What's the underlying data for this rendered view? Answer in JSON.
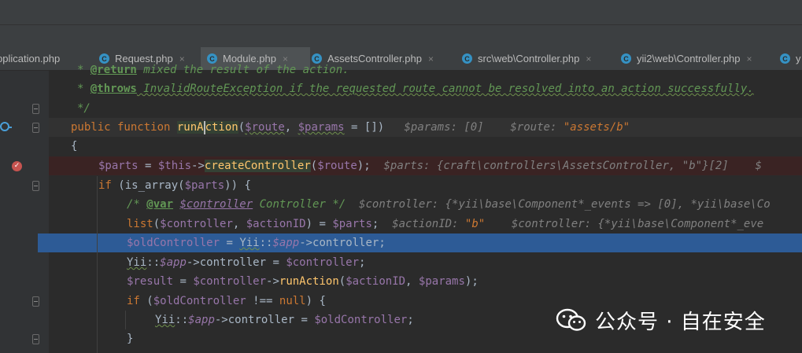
{
  "tabs": [
    {
      "label": "pplication.php",
      "icon_letter": "",
      "active": false
    },
    {
      "label": "Request.php",
      "icon_letter": "C",
      "active": false
    },
    {
      "label": "Module.php",
      "icon_letter": "C",
      "active": true
    },
    {
      "label": "AssetsController.php",
      "icon_letter": "C",
      "active": false
    },
    {
      "label": "src\\web\\Controller.php",
      "icon_letter": "C",
      "active": false
    },
    {
      "label": "yii2\\web\\Controller.php",
      "icon_letter": "C",
      "active": false
    },
    {
      "label": "y",
      "icon_letter": "C",
      "active": false
    }
  ],
  "tab_close_glyph": "×",
  "editor": {
    "l1": {
      "a": "* ",
      "b": "@return",
      "c": " mixed the result of the action."
    },
    "l2": {
      "a": "* ",
      "b": "@throws",
      "c": " InvalidRouteException if the requested route cannot be resolved into an action successfully."
    },
    "l3": {
      "a": "*/"
    },
    "l4": {
      "kw1": "public function ",
      "fn_a": "runA",
      "fn_b": "ction",
      "p1": "(",
      "v1": "$route",
      "p2": ", ",
      "v2": "$params",
      "p3": " = [])",
      "h1": "$params: [0]",
      "h2": "$route: ",
      "h3": "\"assets/b\""
    },
    "l5": {
      "a": "{"
    },
    "l6": {
      "v1": "$parts",
      "a": " = ",
      "v2": "$this",
      "b": "->",
      "fn": "createController",
      "c": "(",
      "v3": "$route",
      "d": ");",
      "h1": "$parts: {craft\\controllers\\AssetsController, \"b\"}[2]",
      "h2": "$"
    },
    "l7": {
      "kw": "if",
      "a": " (is_array(",
      "v": "$parts",
      "b": ")) {"
    },
    "l8": {
      "a": "/* ",
      "tag": "@var",
      "sp": " ",
      "v": "$controller",
      "b": " Controller */",
      "h1": "$controller: {*yii\\base\\Component*_events => [0], *yii\\base\\Co"
    },
    "l9": {
      "kw": "list",
      "a": "(",
      "v1": "$controller",
      "b": ", ",
      "v2": "$actionID",
      "c": ") = ",
      "v3": "$parts",
      "d": ";",
      "h1": "$actionID: ",
      "h1s": "\"b\"",
      "h2": "$controller: {*yii\\base\\Component*_eve"
    },
    "l10": {
      "v1": "$oldController",
      "a": " = ",
      "b": "Yii",
      "c": "::",
      "v2": "$app",
      "d": "->controller;"
    },
    "l11": {
      "a": "Yii",
      "b": "::",
      "v1": "$app",
      "c": "->controller = ",
      "v2": "$controller",
      "d": ";"
    },
    "l12": {
      "v1": "$result",
      "a": " = ",
      "v2": "$controller",
      "b": "->",
      "fn": "runAction",
      "c": "(",
      "v3": "$actionID",
      "d": ", ",
      "v4": "$params",
      "e": ");"
    },
    "l13": {
      "kw1": "if",
      "a": " (",
      "v": "$oldController",
      "b": " !== ",
      "kw2": "null",
      "c": ") {"
    },
    "l14": {
      "a": "Yii",
      "b": "::",
      "v1": "$app",
      "c": "->controller = ",
      "v2": "$oldController",
      "d": ";"
    },
    "l15": {
      "a": "}"
    }
  },
  "gutter": {
    "breakpoint_glyph": "✓"
  },
  "watermark": {
    "text": "公众号 · 自在安全",
    "icon": "wechat-icon"
  },
  "colors": {
    "selection": "#2d5b96",
    "keyword": "#cc7832",
    "variable": "#9876aa",
    "function": "#ffc66d",
    "comment": "#629755"
  }
}
